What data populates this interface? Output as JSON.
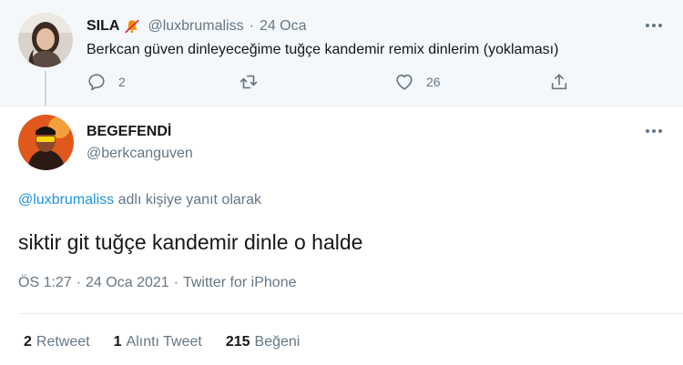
{
  "parent_tweet": {
    "name": "SILA",
    "handle": "@luxbrumaliss",
    "separator": "·",
    "date": "24 Oca",
    "text": "Berkcan güven dinleyeceğime tuğçe kandemir remix dinlerim (yoklaması)",
    "reply_count": "2",
    "retweet_count": "",
    "like_count": "26",
    "icons": [
      "mute-bell-icon",
      "reply-icon",
      "retweet-icon",
      "like-heart-icon",
      "share-icon",
      "more-options-icon"
    ]
  },
  "main_tweet": {
    "name": "BEGEFENDİ",
    "handle": "@berkcanguven",
    "reply_to_handle": "@luxbrumaliss",
    "reply_to_suffix": " adlı kişiye yanıt olarak",
    "text": "siktir git tuğçe kandemir dinle o halde",
    "time": "ÖS 1:27",
    "date": "24 Oca 2021",
    "meta_sep": "·",
    "source": "Twitter for iPhone",
    "stats": [
      {
        "count": "2",
        "label": "Retweet"
      },
      {
        "count": "1",
        "label": "Alıntı Tweet"
      },
      {
        "count": "215",
        "label": "Beğeni"
      }
    ]
  },
  "colors": {
    "accent": "#1b95e0",
    "secondary_text": "#657786",
    "primary_text": "#14171a",
    "parent_background": "#f5f8fa",
    "mute_icon": "#f4900c"
  }
}
